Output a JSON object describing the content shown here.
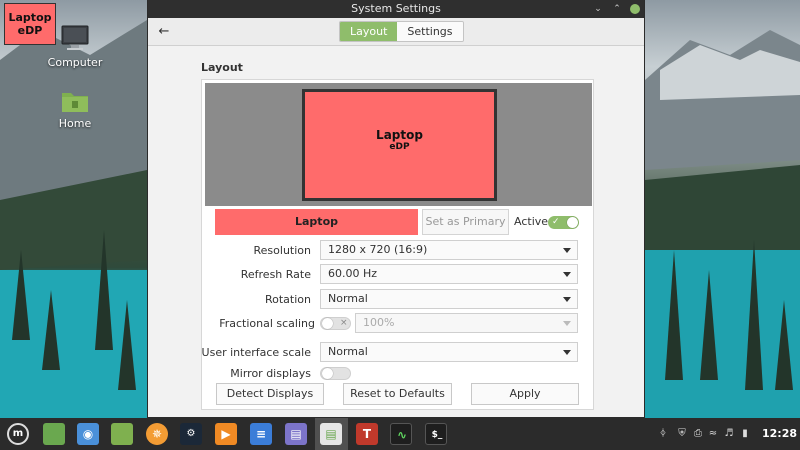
{
  "desktop": {
    "display_indicator": {
      "name": "Laptop",
      "sub": "eDP"
    },
    "icons": [
      {
        "label": "Computer"
      },
      {
        "label": "Home"
      }
    ]
  },
  "window": {
    "title": "System Settings",
    "stack": {
      "layout": "Layout",
      "settings": "Settings",
      "selected": "Layout"
    },
    "section_title": "Layout",
    "preview_monitor": {
      "name": "Laptop",
      "connector": "eDP"
    },
    "monitor_selector": {
      "name": "Laptop",
      "set_primary_label": "Set as Primary",
      "active_label": "Active",
      "active": true
    },
    "rows": {
      "resolution": {
        "label": "Resolution",
        "value": "1280 x 720 (16:9)"
      },
      "refresh_rate": {
        "label": "Refresh Rate",
        "value": "60.00 Hz"
      },
      "rotation": {
        "label": "Rotation",
        "value": "Normal"
      },
      "fractional_scaling": {
        "label": "Fractional scaling",
        "value": "100%",
        "enabled": false
      },
      "ui_scale": {
        "label": "User interface scale",
        "value": "Normal"
      },
      "mirror_displays": {
        "label": "Mirror displays",
        "enabled": false
      }
    },
    "buttons": {
      "detect": "Detect Displays",
      "reset": "Reset to Defaults",
      "apply": "Apply"
    }
  },
  "taskbar": {
    "clock": "12:28",
    "apps": [
      "menu-icon",
      "files-icon",
      "camera-icon",
      "folder-icon",
      "firefox-icon",
      "steam-icon",
      "media-player-icon",
      "text-editor-icon",
      "notes-icon",
      "settings-icon",
      "xfce-app-icon",
      "system-monitor-icon",
      "terminal-icon"
    ],
    "active_app": "settings-icon"
  },
  "colors": {
    "monitor_fill": "#ff6b6b",
    "accent": "#8fbd6b",
    "titlebar": "#2f2f2f",
    "taskbar": "#2b2b2b"
  }
}
